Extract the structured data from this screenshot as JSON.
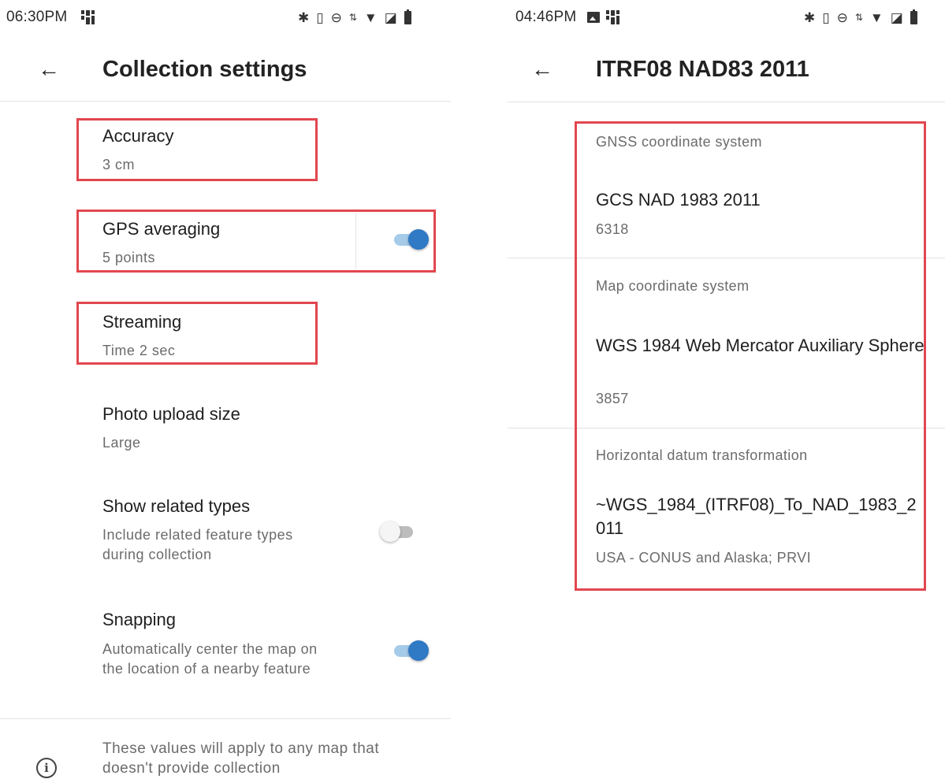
{
  "left_screen": {
    "status_bar": {
      "time": "06:30PM"
    },
    "app_bar": {
      "back_icon": "arrow-left-icon",
      "title": "Collection settings"
    },
    "settings": [
      {
        "title": "Accuracy",
        "subtitle": "3 cm",
        "highlighted": true
      },
      {
        "title": "GPS averaging",
        "subtitle": "5 points",
        "toggle": "on",
        "highlighted": true
      },
      {
        "title": "Streaming",
        "subtitle": "Time 2 sec",
        "highlighted": true
      },
      {
        "title": "Photo upload size",
        "subtitle": "Large"
      },
      {
        "title": "Show related types",
        "subtitle": "Include related feature types during collection",
        "toggle": "off"
      },
      {
        "title": "Snapping",
        "subtitle": "Automatically center the map on the location of a nearby feature",
        "toggle": "on"
      }
    ],
    "footer_note": {
      "icon": "info-icon",
      "text": "These values will apply to any map that doesn't provide collection"
    }
  },
  "right_screen": {
    "status_bar": {
      "time": "04:46PM"
    },
    "app_bar": {
      "back_icon": "arrow-left-icon",
      "title": "ITRF08 NAD83 2011"
    },
    "sections": [
      {
        "label": "GNSS coordinate system",
        "value": "GCS NAD 1983 2011",
        "code": "6318"
      },
      {
        "label": "Map coordinate system",
        "value": "WGS 1984 Web Mercator Auxiliary Sphere",
        "code": "3857"
      },
      {
        "label": "Horizontal datum transformation",
        "value": "~WGS_1984_(ITRF08)_To_NAD_1983_2011",
        "code": "USA - CONUS and Alaska; PRVI"
      }
    ]
  },
  "status_icons": [
    "nfc-icon",
    "bluetooth-icon",
    "vibrate-icon",
    "do-not-disturb-icon",
    "data-arrows-icon",
    "wifi-icon",
    "no-sim-icon",
    "battery-icon"
  ],
  "colors": {
    "highlight_border": "#e2474f",
    "toggle_on": "#2f79c5",
    "toggle_on_track": "#a6cbe9",
    "toggle_off_thumb": "#f5f5f5"
  }
}
